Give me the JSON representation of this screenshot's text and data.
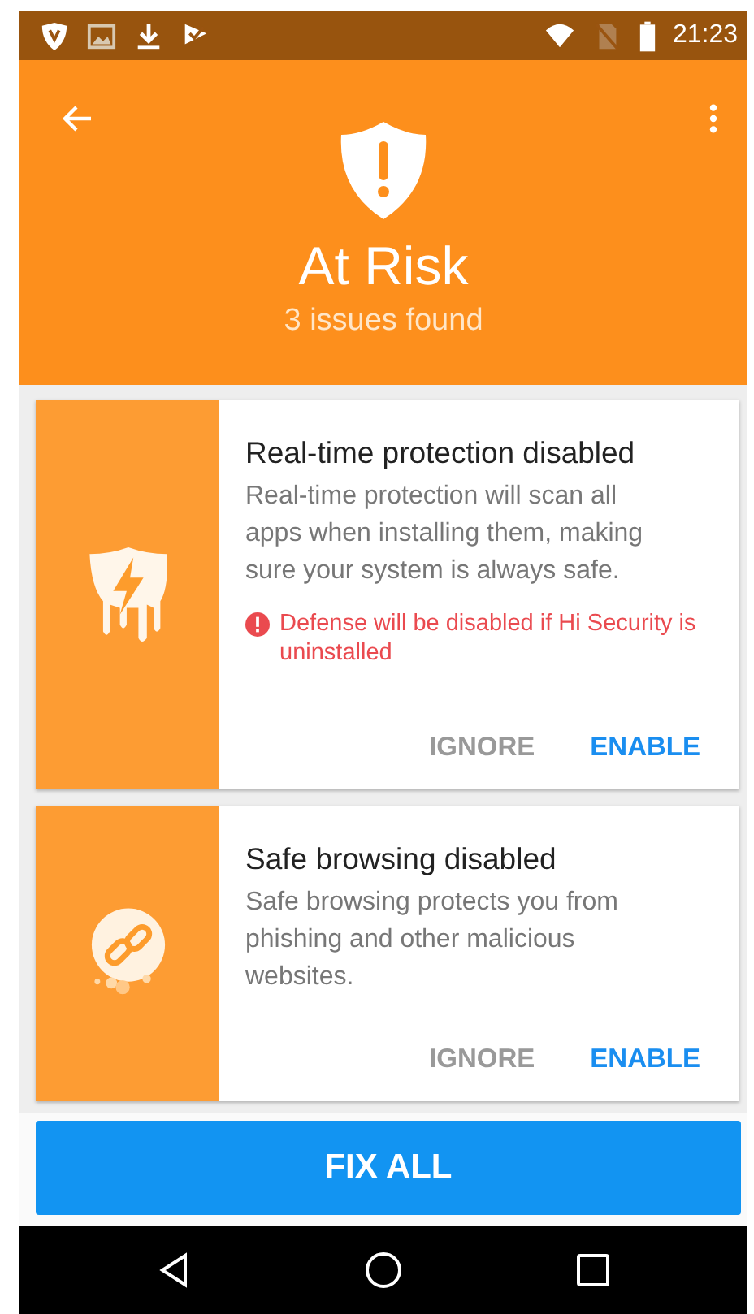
{
  "status_bar": {
    "time": "21:23"
  },
  "header": {
    "title": "At Risk",
    "subtitle": "3 issues found"
  },
  "issues": [
    {
      "title": "Real-time protection disabled",
      "description": "Real-time protection will scan all apps when installing them, making sure your system is always safe.",
      "warning": "Defense will be disabled if Hi Security is uninstalled",
      "actions": [
        "IGNORE",
        "ENABLE"
      ]
    },
    {
      "title": "Safe browsing disabled",
      "description": "Safe browsing protects you from phishing and other malicious websites.",
      "actions": [
        "IGNORE",
        "ENABLE"
      ]
    }
  ],
  "fix_button": "FIX ALL"
}
